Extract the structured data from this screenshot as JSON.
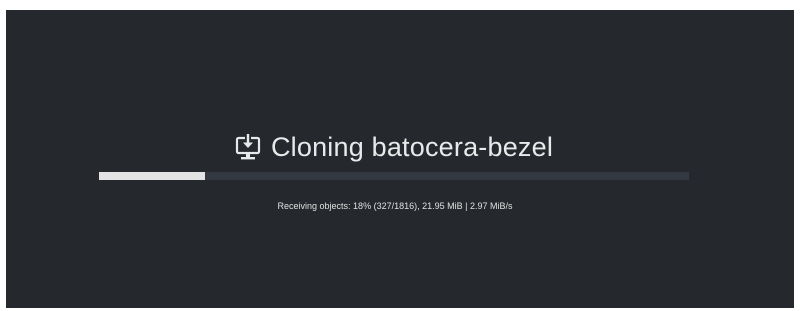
{
  "window": {
    "background_color": "#25282c"
  },
  "clone_dialog": {
    "icon": "download-monitor-icon",
    "title": "Cloning batocera-bezel",
    "progress": {
      "fraction": 0.18,
      "fill_color": "#e3e3e3",
      "track_color": "#343841"
    },
    "status": "Receiving objects: 18% (327/1816), 21.95 MiB | 2.97 MiB/s"
  }
}
